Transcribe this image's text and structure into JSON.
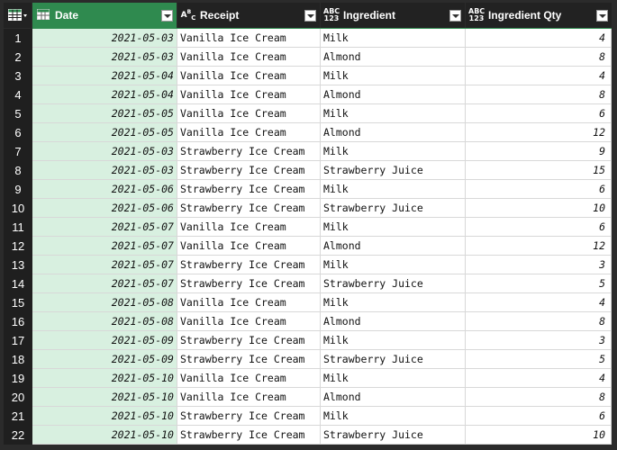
{
  "columns": [
    {
      "label": "Date",
      "type_icon": "table-icon"
    },
    {
      "label": "Receipt",
      "type_icon": "ABC"
    },
    {
      "label": "Ingredient",
      "type_icon": "ABC 123"
    },
    {
      "label": "Ingredient Qty",
      "type_icon": "ABC 123"
    }
  ],
  "colors": {
    "header_active": "#2f8a4f",
    "date_col_bg": "#d8f0e0",
    "header_bg": "#222222"
  },
  "rows": [
    {
      "n": "1",
      "date": "2021-05-03",
      "receipt": "Vanilla Ice Cream",
      "ingredient": "Milk",
      "qty": "4"
    },
    {
      "n": "2",
      "date": "2021-05-03",
      "receipt": "Vanilla Ice Cream",
      "ingredient": "Almond",
      "qty": "8"
    },
    {
      "n": "3",
      "date": "2021-05-04",
      "receipt": "Vanilla Ice Cream",
      "ingredient": "Milk",
      "qty": "4"
    },
    {
      "n": "4",
      "date": "2021-05-04",
      "receipt": "Vanilla Ice Cream",
      "ingredient": "Almond",
      "qty": "8"
    },
    {
      "n": "5",
      "date": "2021-05-05",
      "receipt": "Vanilla Ice Cream",
      "ingredient": "Milk",
      "qty": "6"
    },
    {
      "n": "6",
      "date": "2021-05-05",
      "receipt": "Vanilla Ice Cream",
      "ingredient": "Almond",
      "qty": "12"
    },
    {
      "n": "7",
      "date": "2021-05-03",
      "receipt": "Strawberry Ice Cream",
      "ingredient": "Milk",
      "qty": "9"
    },
    {
      "n": "8",
      "date": "2021-05-03",
      "receipt": "Strawberry Ice Cream",
      "ingredient": "Strawberry Juice",
      "qty": "15"
    },
    {
      "n": "9",
      "date": "2021-05-06",
      "receipt": "Strawberry Ice Cream",
      "ingredient": "Milk",
      "qty": "6"
    },
    {
      "n": "10",
      "date": "2021-05-06",
      "receipt": "Strawberry Ice Cream",
      "ingredient": "Strawberry Juice",
      "qty": "10"
    },
    {
      "n": "11",
      "date": "2021-05-07",
      "receipt": "Vanilla Ice Cream",
      "ingredient": "Milk",
      "qty": "6"
    },
    {
      "n": "12",
      "date": "2021-05-07",
      "receipt": "Vanilla Ice Cream",
      "ingredient": "Almond",
      "qty": "12"
    },
    {
      "n": "13",
      "date": "2021-05-07",
      "receipt": "Strawberry Ice Cream",
      "ingredient": "Milk",
      "qty": "3"
    },
    {
      "n": "14",
      "date": "2021-05-07",
      "receipt": "Strawberry Ice Cream",
      "ingredient": "Strawberry Juice",
      "qty": "5"
    },
    {
      "n": "15",
      "date": "2021-05-08",
      "receipt": "Vanilla Ice Cream",
      "ingredient": "Milk",
      "qty": "4"
    },
    {
      "n": "16",
      "date": "2021-05-08",
      "receipt": "Vanilla Ice Cream",
      "ingredient": "Almond",
      "qty": "8"
    },
    {
      "n": "17",
      "date": "2021-05-09",
      "receipt": "Strawberry Ice Cream",
      "ingredient": "Milk",
      "qty": "3"
    },
    {
      "n": "18",
      "date": "2021-05-09",
      "receipt": "Strawberry Ice Cream",
      "ingredient": "Strawberry Juice",
      "qty": "5"
    },
    {
      "n": "19",
      "date": "2021-05-10",
      "receipt": "Vanilla Ice Cream",
      "ingredient": "Milk",
      "qty": "4"
    },
    {
      "n": "20",
      "date": "2021-05-10",
      "receipt": "Vanilla Ice Cream",
      "ingredient": "Almond",
      "qty": "8"
    },
    {
      "n": "21",
      "date": "2021-05-10",
      "receipt": "Strawberry Ice Cream",
      "ingredient": "Milk",
      "qty": "6"
    },
    {
      "n": "22",
      "date": "2021-05-10",
      "receipt": "Strawberry Ice Cream",
      "ingredient": "Strawberry Juice",
      "qty": "10"
    }
  ]
}
